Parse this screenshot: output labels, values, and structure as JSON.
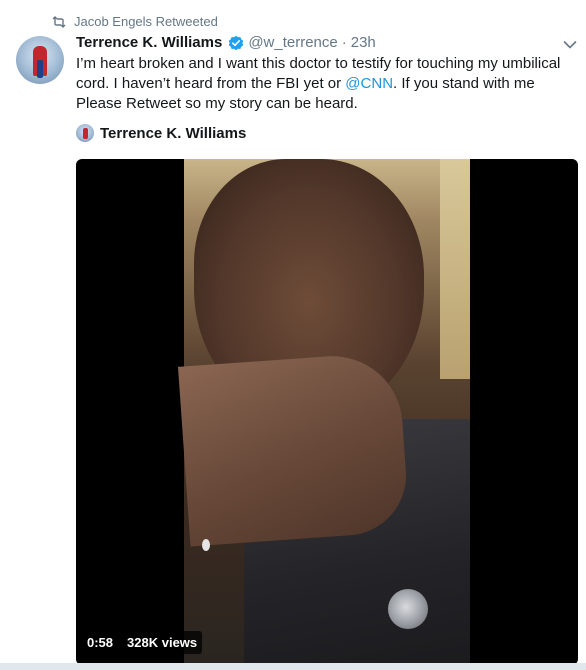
{
  "retweet": {
    "label": "Jacob Engels Retweeted",
    "icon": "retweet-icon"
  },
  "author": {
    "name": "Terrence K. Williams",
    "verified_icon": "verified-badge-icon",
    "handle": "@w_terrence",
    "separator": "·",
    "time": "23h"
  },
  "tweet": {
    "text_part1": "I’m heart broken and I want this doctor to testify  for touching my umbilical cord. I haven’t heard from the FBI yet or ",
    "mention": "@CNN",
    "text_part2": ". If you stand with me Please Retweet so my story can be heard."
  },
  "card": {
    "author_name": "Terrence K. Williams"
  },
  "video": {
    "duration": "0:58",
    "views": "328K views"
  },
  "colors": {
    "link": "#1b95e0",
    "verified": "#1da1f2",
    "muted": "#657786"
  }
}
